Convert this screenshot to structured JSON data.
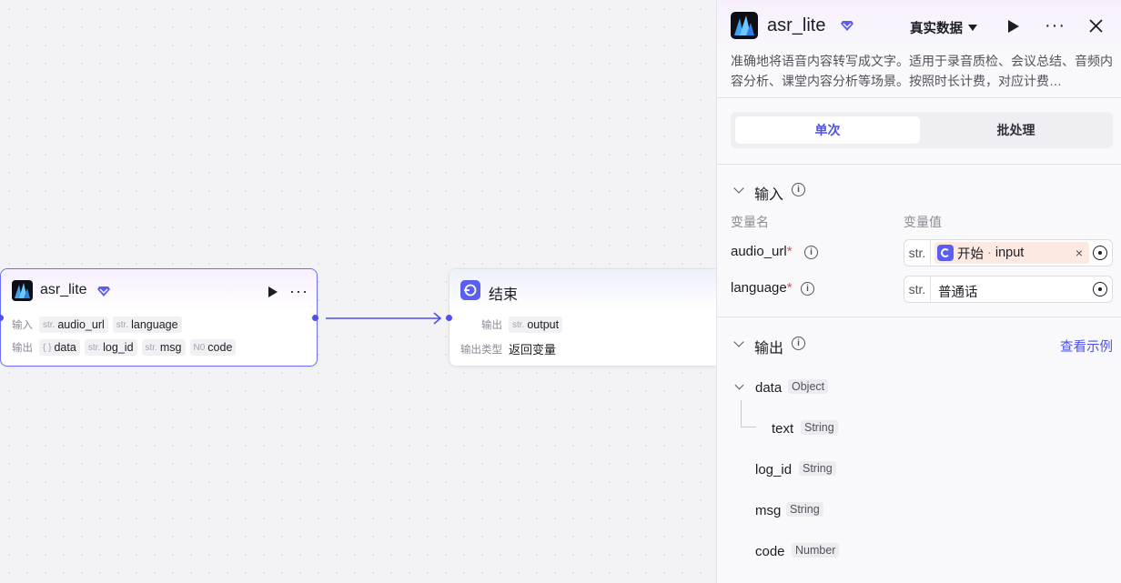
{
  "canvas": {
    "asr_node": {
      "title": "asr_lite",
      "input_label": "输入",
      "inputs": [
        {
          "type": "str.",
          "name": "audio_url"
        },
        {
          "type": "str.",
          "name": "language"
        }
      ],
      "output_label": "输出",
      "outputs": [
        {
          "type": "{ }",
          "name": "data"
        },
        {
          "type": "str.",
          "name": "log_id"
        },
        {
          "type": "str.",
          "name": "msg"
        },
        {
          "type": "N0",
          "name": "code"
        }
      ]
    },
    "end_node": {
      "title": "结束",
      "output_label": "输出",
      "output": {
        "type": "str.",
        "name": "output"
      },
      "output_type_label": "输出类型",
      "output_type_value": "返回变量"
    }
  },
  "panel": {
    "title": "asr_lite",
    "data_mode": "真实数据",
    "description": "准确地将语音内容转写成文字。适用于录音质检、会议总结、音频内容分析、课堂内容分析等场景。按照时长计费，对应计费…",
    "tabs": [
      {
        "label": "单次",
        "active": true
      },
      {
        "label": "批处理",
        "active": false
      }
    ],
    "input_section": {
      "title": "输入",
      "col_name": "变量名",
      "col_value": "变量值",
      "vars": [
        {
          "name": "audio_url",
          "required": "*",
          "type": "str.",
          "ref_node": "开始",
          "ref_sep": "·",
          "ref_var": "input"
        },
        {
          "name": "language",
          "required": "*",
          "type": "str.",
          "value": "普通话"
        }
      ]
    },
    "output_section": {
      "title": "输出",
      "view_example": "查看示例",
      "fields": [
        {
          "name": "data",
          "type": "Object"
        },
        {
          "name": "text",
          "type": "String"
        },
        {
          "name": "log_id",
          "type": "String"
        },
        {
          "name": "msg",
          "type": "String"
        },
        {
          "name": "code",
          "type": "Number"
        }
      ]
    }
  },
  "colors": {
    "accent": "#4e51e6",
    "selected_border": "#6b6ff2",
    "required": "#e5484d",
    "ref_bg": "#fbe9e2"
  }
}
